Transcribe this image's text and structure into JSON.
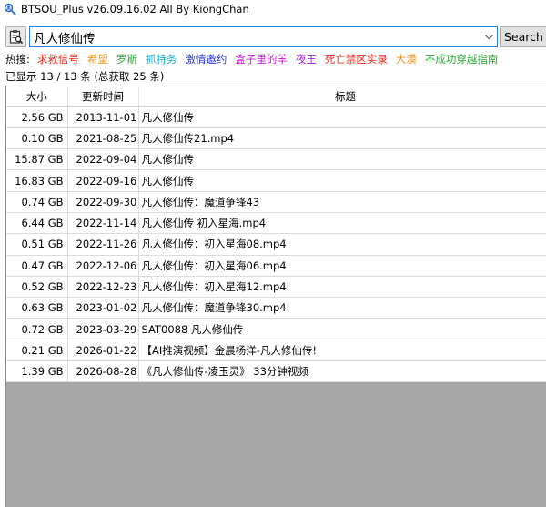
{
  "window": {
    "title": "BTSOU_Plus v26.09.16.02 All By KiongChan",
    "icon": "magnifier-person-icon"
  },
  "search": {
    "query": "凡人修仙传",
    "button_label": "Search A"
  },
  "hot": {
    "label": "热搜:",
    "items": [
      {
        "text": "求救信号",
        "color": "#e8281c"
      },
      {
        "text": "希望",
        "color": "#f0901a"
      },
      {
        "text": "罗斯",
        "color": "#2fa83a"
      },
      {
        "text": "抓特务",
        "color": "#18a8c8"
      },
      {
        "text": "激情邀约",
        "color": "#1e2ee0"
      },
      {
        "text": "盒子里的羊",
        "color": "#c418d8"
      },
      {
        "text": "夜王",
        "color": "#9a1ad0"
      },
      {
        "text": "死亡禁区实录",
        "color": "#e8281c"
      },
      {
        "text": "大漠",
        "color": "#f0901a"
      },
      {
        "text": "不成功穿越指南",
        "color": "#2fa83a"
      }
    ]
  },
  "status": "已显示 13 / 13 条 (总获取 25 条)",
  "table": {
    "headers": {
      "size": "大小",
      "date": "更新时间",
      "title": "标题"
    },
    "rows": [
      {
        "size": "2.56 GB",
        "date": "2013-11-01",
        "title": "凡人修仙传"
      },
      {
        "size": "0.10 GB",
        "date": "2021-08-25",
        "title": "凡人修仙传21.mp4"
      },
      {
        "size": "15.87 GB",
        "date": "2022-09-04",
        "title": "凡人修仙传"
      },
      {
        "size": "16.83 GB",
        "date": "2022-09-16",
        "title": "凡人修仙传"
      },
      {
        "size": "0.74 GB",
        "date": "2022-09-30",
        "title": "凡人修仙传：魔道争锋43"
      },
      {
        "size": "6.44 GB",
        "date": "2022-11-14",
        "title": "凡人修仙传 初入星海.mp4"
      },
      {
        "size": "0.51 GB",
        "date": "2022-11-26",
        "title": "凡人修仙传：初入星海08.mp4"
      },
      {
        "size": "0.47 GB",
        "date": "2022-12-06",
        "title": "凡人修仙传：初入星海06.mp4"
      },
      {
        "size": "0.52 GB",
        "date": "2022-12-23",
        "title": "凡人修仙传：初入星海12.mp4"
      },
      {
        "size": "0.63 GB",
        "date": "2023-01-02",
        "title": "凡人修仙传：魔道争锋30.mp4"
      },
      {
        "size": "0.72 GB",
        "date": "2023-03-29",
        "title": "SAT0088 凡人修仙传"
      },
      {
        "size": "0.21 GB",
        "date": "2026-01-22",
        "title": "【AI推演视频】金晨杨洋-凡人修仙传!"
      },
      {
        "size": "1.39 GB",
        "date": "2026-08-28",
        "title": "《凡人修仙传-凌玉灵》 33分钟视频"
      }
    ]
  }
}
